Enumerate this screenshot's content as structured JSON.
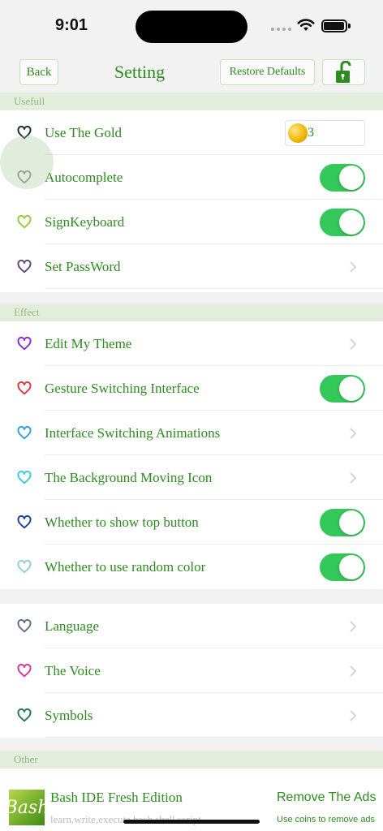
{
  "status_bar": {
    "time": "9:01",
    "icons": [
      "cellular-dots-icon",
      "wifi-icon",
      "battery-icon"
    ]
  },
  "nav": {
    "back_label": "Back",
    "title": "Setting",
    "restore_label": "Restore Defaults",
    "lock_icon": "unlock-icon",
    "accent": "#2e8b1f"
  },
  "sections": {
    "usefull": {
      "header": "Usefull",
      "rows": [
        {
          "label": "Use The Gold",
          "heart_color": "#1b2a33",
          "control": "gold-field",
          "value": "3"
        },
        {
          "label": "Autocomplete",
          "heart_color": "#9a8f86",
          "control": "toggle",
          "on": true
        },
        {
          "label": "SignKeyboard",
          "heart_color": "#8fce3a",
          "control": "toggle",
          "on": true
        },
        {
          "label": "Set PassWord",
          "heart_color": "#5a4a73",
          "control": "chevron"
        }
      ]
    },
    "effect": {
      "header": "Effect",
      "rows": [
        {
          "label": "Edit My Theme",
          "heart_color": "#8a2bd8",
          "control": "chevron"
        },
        {
          "label": "Gesture Switching Interface",
          "heart_color": "#e0353b",
          "control": "toggle",
          "on": true
        },
        {
          "label": "Interface Switching Animations",
          "heart_color": "#2f9fe0",
          "control": "chevron"
        },
        {
          "label": "The Background Moving Icon",
          "heart_color": "#3ec8e8",
          "control": "chevron"
        },
        {
          "label": "Whether to show top button",
          "heart_color": "#1a3ea8",
          "control": "toggle",
          "on": true
        },
        {
          "label": "Whether to use random color",
          "heart_color": "#8fd3c8",
          "control": "toggle",
          "on": true
        }
      ]
    },
    "misc": {
      "rows": [
        {
          "label": "Language",
          "heart_color": "#5e6f8c",
          "control": "chevron"
        },
        {
          "label": "The Voice",
          "heart_color": "#d8339a",
          "control": "chevron"
        },
        {
          "label": "Symbols",
          "heart_color": "#1a7a5e",
          "control": "chevron"
        }
      ]
    },
    "other": {
      "header": "Other"
    }
  },
  "ad": {
    "logo_text": "Bash",
    "title": "Bash IDE Fresh Edition",
    "subtitle": "learn,write,execute bash shell script",
    "remove_title": "Remove The Ads",
    "remove_sub": "Use coins to remove ads"
  },
  "colors": {
    "accent": "#2e8b1f",
    "section_bg": "#e2eedb",
    "toggle_on": "#34c759"
  }
}
